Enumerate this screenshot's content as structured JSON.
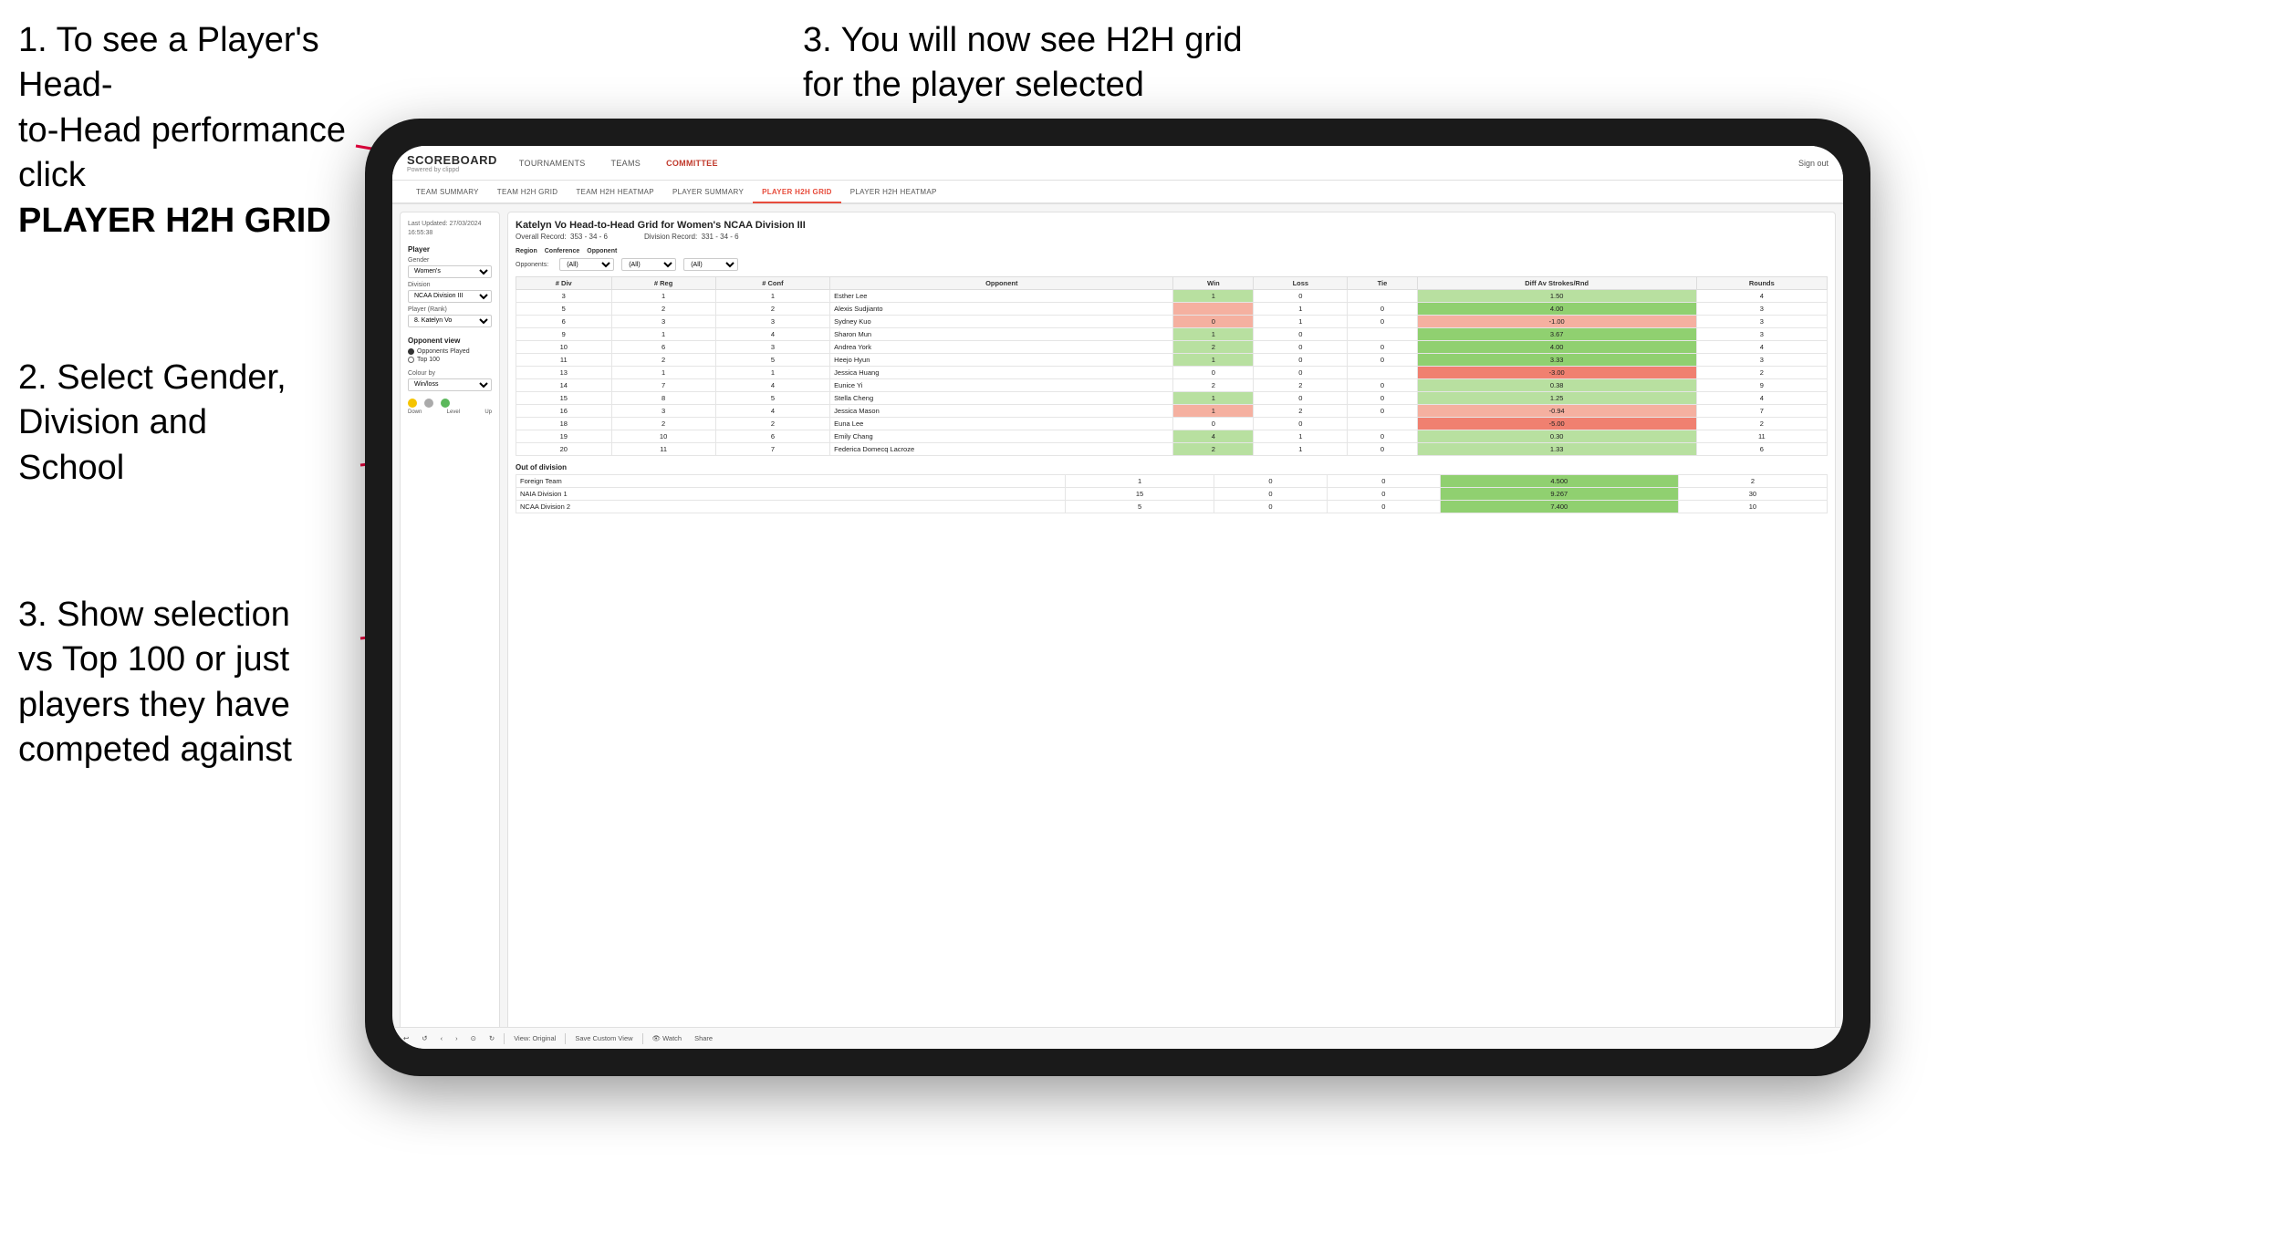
{
  "instructions": {
    "step1_line1": "1. To see a Player's Head-",
    "step1_line2": "to-Head performance click",
    "step1_bold": "PLAYER H2H GRID",
    "step2_line1": "2. Select Gender,",
    "step2_line2": "Division and",
    "step2_line3": "School",
    "step3_top_line1": "3. You will now see H2H grid",
    "step3_top_line2": "for the player selected",
    "step3_bottom_line1": "3. Show selection",
    "step3_bottom_line2": "vs Top 100 or just",
    "step3_bottom_line3": "players they have",
    "step3_bottom_line4": "competed against"
  },
  "nav": {
    "logo": "SCOREBOARD",
    "logo_sub": "Powered by clippd",
    "items": [
      "TOURNAMENTS",
      "TEAMS",
      "COMMITTEE"
    ],
    "sign_out": "Sign out"
  },
  "sub_nav": {
    "items": [
      "TEAM SUMMARY",
      "TEAM H2H GRID",
      "TEAM H2H HEATMAP",
      "PLAYER SUMMARY",
      "PLAYER H2H GRID",
      "PLAYER H2H HEATMAP"
    ]
  },
  "left_panel": {
    "timestamp_label": "Last Updated: 27/03/2024",
    "timestamp_time": "16:55:38",
    "player_section": "Player",
    "gender_label": "Gender",
    "gender_value": "Women's",
    "division_label": "Division",
    "division_value": "NCAA Division III",
    "player_rank_label": "Player (Rank)",
    "player_rank_value": "8. Katelyn Vo",
    "opponent_view_label": "Opponent view",
    "opponent_played": "Opponents Played",
    "top100": "Top 100",
    "colour_by_label": "Colour by",
    "colour_by_value": "Win/loss",
    "legend_down": "Down",
    "legend_level": "Level",
    "legend_up": "Up"
  },
  "grid": {
    "title": "Katelyn Vo Head-to-Head Grid for Women's NCAA Division III",
    "overall_record_label": "Overall Record:",
    "overall_record_value": "353 - 34 - 6",
    "division_record_label": "Division Record:",
    "division_record_value": "331 - 34 - 6",
    "region_label": "Region",
    "conference_label": "Conference",
    "opponent_label": "Opponent",
    "opponents_label": "Opponents:",
    "all_option": "(All)",
    "col_div": "# Div",
    "col_reg": "# Reg",
    "col_conf": "# Conf",
    "col_opponent": "Opponent",
    "col_win": "Win",
    "col_loss": "Loss",
    "col_tie": "Tie",
    "col_diff": "Diff Av Strokes/Rnd",
    "col_rounds": "Rounds",
    "rows": [
      {
        "div": "3",
        "reg": "1",
        "conf": "1",
        "opponent": "Esther Lee",
        "win": "1",
        "loss": "0",
        "tie": "",
        "diff": "1.50",
        "rounds": "4"
      },
      {
        "div": "5",
        "reg": "2",
        "conf": "2",
        "opponent": "Alexis Sudjianto",
        "win": "",
        "loss": "1",
        "tie": "0",
        "diff": "4.00",
        "rounds": "3"
      },
      {
        "div": "6",
        "reg": "3",
        "conf": "3",
        "opponent": "Sydney Kuo",
        "win": "0",
        "loss": "1",
        "tie": "0",
        "diff": "-1.00",
        "rounds": "3"
      },
      {
        "div": "9",
        "reg": "1",
        "conf": "4",
        "opponent": "Sharon Mun",
        "win": "1",
        "loss": "0",
        "tie": "",
        "diff": "3.67",
        "rounds": "3"
      },
      {
        "div": "10",
        "reg": "6",
        "conf": "3",
        "opponent": "Andrea York",
        "win": "2",
        "loss": "0",
        "tie": "0",
        "diff": "4.00",
        "rounds": "4"
      },
      {
        "div": "11",
        "reg": "2",
        "conf": "5",
        "opponent": "Heejo Hyun",
        "win": "1",
        "loss": "0",
        "tie": "0",
        "diff": "3.33",
        "rounds": "3"
      },
      {
        "div": "13",
        "reg": "1",
        "conf": "1",
        "opponent": "Jessica Huang",
        "win": "0",
        "loss": "0",
        "tie": "",
        "diff": "-3.00",
        "rounds": "2"
      },
      {
        "div": "14",
        "reg": "7",
        "conf": "4",
        "opponent": "Eunice Yi",
        "win": "2",
        "loss": "2",
        "tie": "0",
        "diff": "0.38",
        "rounds": "9"
      },
      {
        "div": "15",
        "reg": "8",
        "conf": "5",
        "opponent": "Stella Cheng",
        "win": "1",
        "loss": "0",
        "tie": "0",
        "diff": "1.25",
        "rounds": "4"
      },
      {
        "div": "16",
        "reg": "3",
        "conf": "4",
        "opponent": "Jessica Mason",
        "win": "1",
        "loss": "2",
        "tie": "0",
        "diff": "-0.94",
        "rounds": "7"
      },
      {
        "div": "18",
        "reg": "2",
        "conf": "2",
        "opponent": "Euna Lee",
        "win": "0",
        "loss": "0",
        "tie": "",
        "diff": "-5.00",
        "rounds": "2"
      },
      {
        "div": "19",
        "reg": "10",
        "conf": "6",
        "opponent": "Emily Chang",
        "win": "4",
        "loss": "1",
        "tie": "0",
        "diff": "0.30",
        "rounds": "11"
      },
      {
        "div": "20",
        "reg": "11",
        "conf": "7",
        "opponent": "Federica Domecq Lacroze",
        "win": "2",
        "loss": "1",
        "tie": "0",
        "diff": "1.33",
        "rounds": "6"
      }
    ],
    "out_of_division_label": "Out of division",
    "out_rows": [
      {
        "opponent": "Foreign Team",
        "win": "1",
        "loss": "0",
        "tie": "0",
        "diff": "4.500",
        "rounds": "2"
      },
      {
        "opponent": "NAIA Division 1",
        "win": "15",
        "loss": "0",
        "tie": "0",
        "diff": "9.267",
        "rounds": "30"
      },
      {
        "opponent": "NCAA Division 2",
        "win": "5",
        "loss": "0",
        "tie": "0",
        "diff": "7.400",
        "rounds": "10"
      }
    ]
  },
  "toolbar": {
    "view_original": "View: Original",
    "save_custom_view": "Save Custom View",
    "watch": "Watch",
    "share": "Share"
  }
}
